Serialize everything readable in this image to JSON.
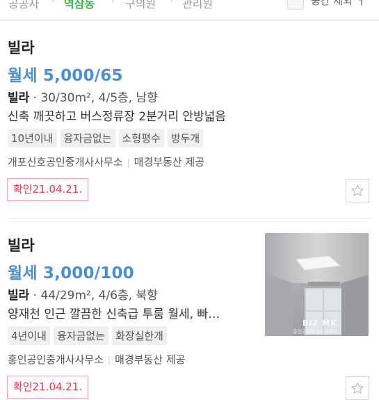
{
  "header": {
    "breadcrumbs": [
      "공공사",
      "역삼동",
      "구의원",
      "관리원"
    ],
    "checkbox_label": "중간 제외 ㅓ"
  },
  "listings": [
    {
      "type": "빌라",
      "price": "월세 5,000/65",
      "spec_type": "빌라",
      "spec_detail": " · 30/30m², 4/5층, 남향",
      "description": "신축 깨끗하고 버스정류장 2분거리 안방넓음",
      "tags": [
        "10년이내",
        "융자금없는",
        "소형평수",
        "방두개"
      ],
      "agency": "개포신호공인중개사사무소",
      "provider": "매경부동산 제공",
      "confirmed": "확인21.04.21."
    },
    {
      "type": "빌라",
      "price": "월세 3,000/100",
      "spec_type": "빌라",
      "spec_detail": " · 44/29m², 4/6층, 북향",
      "description": "양재천 인근 깔끔한 신축급 투룸 월세, 빠…",
      "tags": [
        "4년이내",
        "융자금없는",
        "화장실한개"
      ],
      "agency": "홍인공인중개사사무소",
      "provider": "매경부동산 제공",
      "confirmed": "확인21.04.21.",
      "photo_watermark": "BIZ MK",
      "photo_caption": "홍인공인중개사사무소"
    }
  ]
}
